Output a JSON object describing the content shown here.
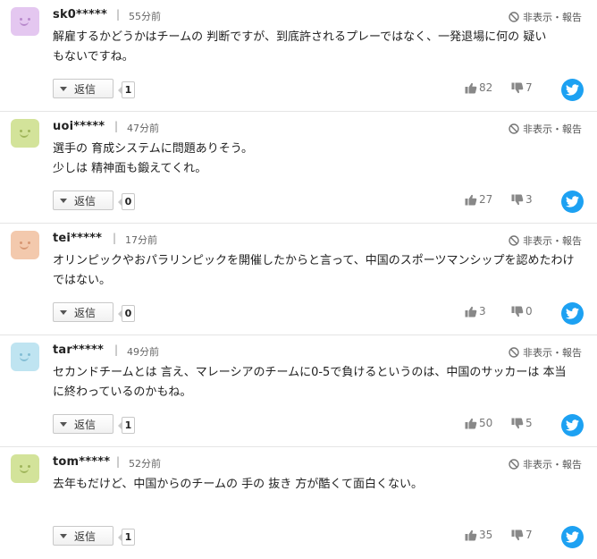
{
  "report_label": "非表示・報告",
  "reply_label": "返信",
  "colors": {
    "twitter": "#1da1f2",
    "icon_gray": "#888888"
  },
  "comments": [
    {
      "username": "sk0*****",
      "time": "55分前",
      "lines": [
        "解雇するかどうかはチームの 判断ですが、到底許されるプレーではなく、一発退場に何の 疑い",
        "もないですね。"
      ],
      "reply_count": "1",
      "good": "82",
      "bad": "7",
      "avatar_bg": "#e4c7f0",
      "avatar_fg": "#b889cc"
    },
    {
      "username": "uoi*****",
      "time": "47分前",
      "lines": [
        "選手の 育成システムに問題ありそう。",
        "少しは 精神面も鍛えてくれ。"
      ],
      "reply_count": "0",
      "good": "27",
      "bad": "3",
      "avatar_bg": "#d3e39a",
      "avatar_fg": "#9fb55a"
    },
    {
      "username": "tei*****",
      "time": "17分前",
      "lines": [
        "オリンピックやおパラリンピックを開催したからと言って、中国のスポーツマンシップを認めたわけ",
        "ではない。"
      ],
      "reply_count": "0",
      "good": "3",
      "bad": "0",
      "avatar_bg": "#f3c9ad",
      "avatar_fg": "#d79672"
    },
    {
      "username": "tar*****",
      "time": "49分前",
      "lines": [
        "セカンドチームとは 言え、マレーシアのチームに0-5で負けるというのは、中国のサッカーは 本当",
        "に終わっているのかもね。"
      ],
      "reply_count": "1",
      "good": "50",
      "bad": "5",
      "avatar_bg": "#bfe4f1",
      "avatar_fg": "#82bdd4"
    },
    {
      "username": "tom*****",
      "time": "52分前",
      "lines": [
        "去年もだけど、中国からのチームの 手の 抜き 方が酷くて面白くない。"
      ],
      "reply_count": "1",
      "good": "35",
      "bad": "7",
      "avatar_bg": "#d3e39a",
      "avatar_fg": "#9fb55a"
    }
  ]
}
